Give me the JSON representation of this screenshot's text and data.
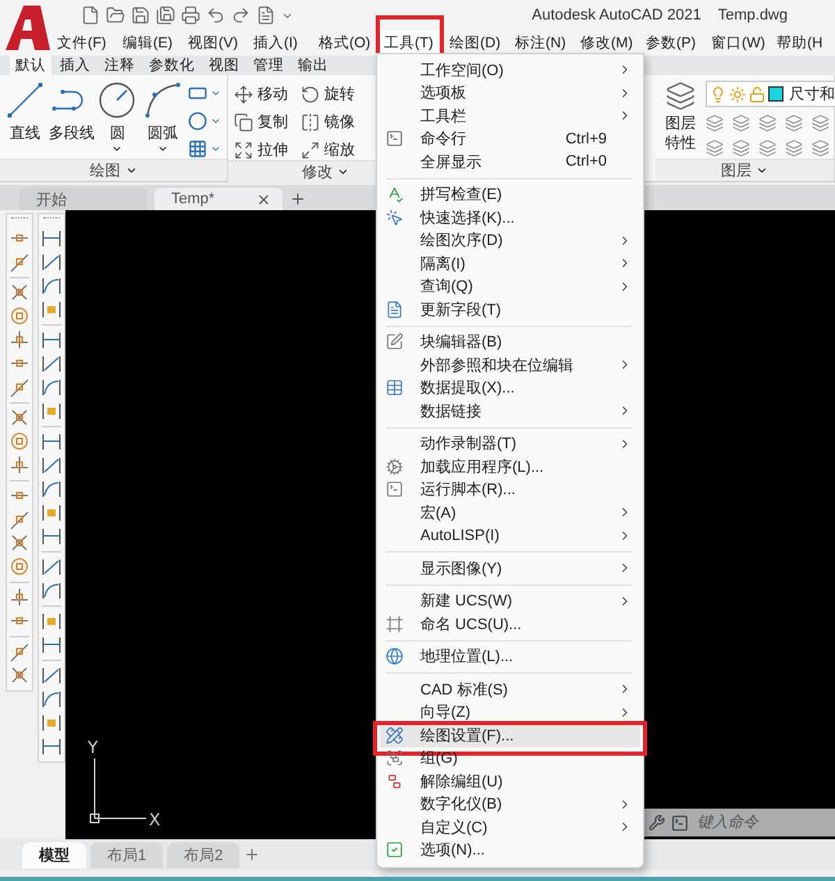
{
  "title": {
    "app": "Autodesk AutoCAD 2021",
    "file": "Temp.dwg"
  },
  "menubar": [
    {
      "label": "文件(F)",
      "selected": false
    },
    {
      "label": "编辑(E)",
      "selected": false
    },
    {
      "label": "视图(V)",
      "selected": false
    },
    {
      "label": "插入(I)",
      "selected": false
    },
    {
      "label": "格式(O)",
      "selected": false
    },
    {
      "label": "工具(T)",
      "selected": true,
      "annotated": true
    },
    {
      "label": "绘图(D)",
      "selected": false
    },
    {
      "label": "标注(N)",
      "selected": false
    },
    {
      "label": "修改(M)",
      "selected": false
    },
    {
      "label": "参数(P)",
      "selected": false
    },
    {
      "label": "窗口(W)",
      "selected": false
    },
    {
      "label": "帮助(H",
      "selected": false
    }
  ],
  "ribbon_tabs": [
    {
      "label": "默认",
      "selected": true
    },
    {
      "label": "插入",
      "selected": false
    },
    {
      "label": "注释",
      "selected": false
    },
    {
      "label": "参数化",
      "selected": false
    },
    {
      "label": "视图",
      "selected": false
    },
    {
      "label": "管理",
      "selected": false
    },
    {
      "label": "输出",
      "selected": false
    }
  ],
  "draw_panel": {
    "title": "绘图",
    "tools": [
      {
        "label": "直线",
        "dropdown": false
      },
      {
        "label": "多段线",
        "dropdown": false
      },
      {
        "label": "圆",
        "dropdown": true
      },
      {
        "label": "圆弧",
        "dropdown": true
      }
    ]
  },
  "modify_panel": {
    "title": "修改",
    "tools": [
      "移动",
      "旋转",
      "复制",
      "镜像",
      "拉伸",
      "缩放"
    ]
  },
  "layer_panel": {
    "title": "图层",
    "properties": "图层特性",
    "current_layer": "尺寸和"
  },
  "document_tabs": [
    {
      "label": "开始",
      "selected": false
    },
    {
      "label": "Temp*",
      "selected": true
    }
  ],
  "ucs": {
    "x": "X",
    "y": "Y"
  },
  "command_line": {
    "placeholder": "键入命令"
  },
  "layout_tabs": [
    {
      "label": "模型",
      "selected": true
    },
    {
      "label": "布局1",
      "selected": false
    },
    {
      "label": "布局2",
      "selected": false
    }
  ],
  "tools_menu": {
    "groups": [
      [
        {
          "label": "工作空间(O)",
          "submenu": true,
          "selected": false
        },
        {
          "label": "选项板",
          "submenu": true,
          "selected": false
        },
        {
          "label": "工具栏",
          "submenu": true,
          "selected": false
        },
        {
          "label": "命令行",
          "shortcut": "Ctrl+9",
          "submenu": false,
          "selected": false
        },
        {
          "label": "全屏显示",
          "shortcut": "Ctrl+0",
          "submenu": false,
          "selected": false
        }
      ],
      [
        {
          "label": "拼写检查(E)",
          "submenu": false,
          "selected": false
        },
        {
          "label": "快速选择(K)...",
          "submenu": false,
          "selected": false
        },
        {
          "label": "绘图次序(D)",
          "submenu": true,
          "selected": false
        },
        {
          "label": "隔离(I)",
          "submenu": true,
          "selected": false
        },
        {
          "label": "查询(Q)",
          "submenu": true,
          "selected": false
        },
        {
          "label": "更新字段(T)",
          "submenu": false,
          "selected": false
        }
      ],
      [
        {
          "label": "块编辑器(B)",
          "submenu": false,
          "selected": false
        },
        {
          "label": "外部参照和块在位编辑",
          "submenu": true,
          "selected": false
        },
        {
          "label": "数据提取(X)...",
          "submenu": false,
          "selected": false
        },
        {
          "label": "数据链接",
          "submenu": true,
          "selected": false
        }
      ],
      [
        {
          "label": "动作录制器(T)",
          "submenu": true,
          "selected": false
        },
        {
          "label": "加载应用程序(L)...",
          "submenu": false,
          "selected": false
        },
        {
          "label": "运行脚本(R)...",
          "submenu": false,
          "selected": false
        },
        {
          "label": "宏(A)",
          "submenu": true,
          "selected": false
        },
        {
          "label": "AutoLISP(I)",
          "submenu": true,
          "selected": false
        }
      ],
      [
        {
          "label": "显示图像(Y)",
          "submenu": true,
          "selected": false
        }
      ],
      [
        {
          "label": "新建 UCS(W)",
          "submenu": true,
          "selected": false
        },
        {
          "label": "命名 UCS(U)...",
          "submenu": false,
          "selected": false
        }
      ],
      [
        {
          "label": "地理位置(L)...",
          "submenu": false,
          "selected": false
        }
      ],
      [
        {
          "label": "CAD 标准(S)",
          "submenu": true,
          "selected": false
        },
        {
          "label": "向导(Z)",
          "submenu": true,
          "selected": false
        },
        {
          "label": "绘图设置(F)...",
          "submenu": false,
          "selected": true,
          "annotated": true
        },
        {
          "label": "组(G)",
          "submenu": false,
          "selected": false
        },
        {
          "label": "解除编组(U)",
          "submenu": false,
          "selected": false
        },
        {
          "label": "数字化仪(B)",
          "submenu": true,
          "selected": false
        },
        {
          "label": "自定义(C)",
          "submenu": true,
          "selected": false
        },
        {
          "label": "选项(N)...",
          "submenu": false,
          "selected": false
        }
      ]
    ]
  }
}
